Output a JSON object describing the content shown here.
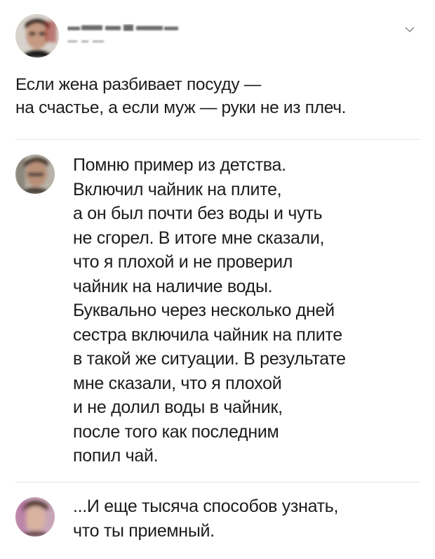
{
  "post": {
    "lines": [
      "Если жена разбивает посуду —",
      "на счастье, а если муж — руки не из плеч."
    ]
  },
  "replies": [
    {
      "lines": [
        "Помню пример из детства.",
        "Включил чайник на плите,",
        "а он был почти без воды и чуть",
        "не сгорел. В итоге мне сказали,",
        "что я плохой и не проверил",
        "чайник на наличие воды.",
        "Буквально через несколько дней",
        "сестра включила чайник на плите",
        "в такой же ситуации. В результате",
        "мне сказали, что я плохой",
        "и не долил воды в чайник,",
        "после того как последним",
        "попил чай."
      ]
    },
    {
      "lines": [
        "...И еще тысяча способов узнать,",
        "что ты приемный."
      ]
    }
  ],
  "icons": {
    "menu": "chevron-down-icon"
  },
  "colors": {
    "text": "#1c1c1c",
    "divider": "#e3e3e3",
    "chevron": "#8a8a8a"
  }
}
